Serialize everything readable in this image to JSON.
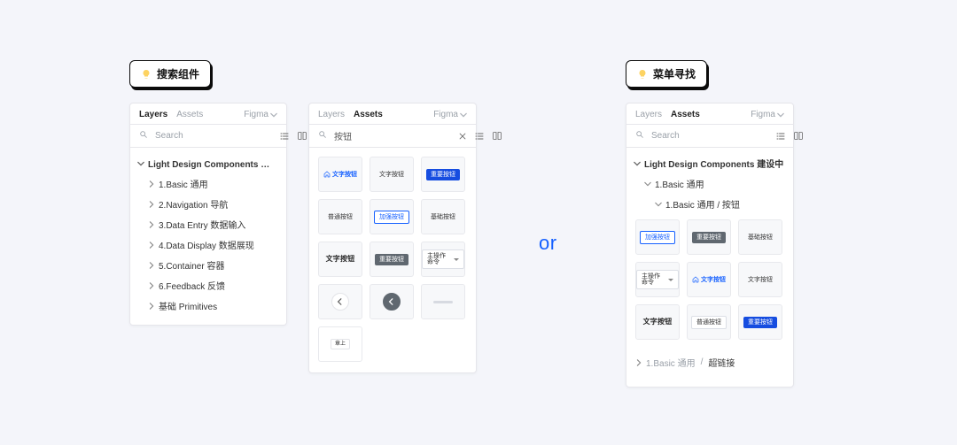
{
  "badges": {
    "search": "搜索组件",
    "menu": "菜单寻找"
  },
  "or_text": "or",
  "panel_tabs": {
    "layers": "Layers",
    "assets": "Assets",
    "file_name": "Figma"
  },
  "search": {
    "placeholder": "Search",
    "query_text": "按钮"
  },
  "layer_tree_left": {
    "root": "Light Design Components 建设中",
    "items": [
      "1.Basic 通用",
      "2.Navigation 导航",
      "3.Data Entry 数据输入",
      "4.Data Display 数据展现",
      "5.Container 容器",
      "6.Feedback 反馈",
      "基础 Primitives"
    ]
  },
  "layer_tree_right": {
    "root": "Light Design Components 建设中",
    "branch1": "1.Basic 通用",
    "branch2": "1.Basic 通用 / 按钮",
    "crumb_parent": "1.Basic 通用",
    "crumb_leaf": "超链接"
  },
  "tile_labels": {
    "text_btn": "文字按钮",
    "primary_btn": "重要按钮",
    "normal_btn": "普通按钮",
    "enhanced_btn": "加强按钮",
    "basic_btn": "基础按钮",
    "main_action": "主操作命令",
    "top": "章上"
  }
}
